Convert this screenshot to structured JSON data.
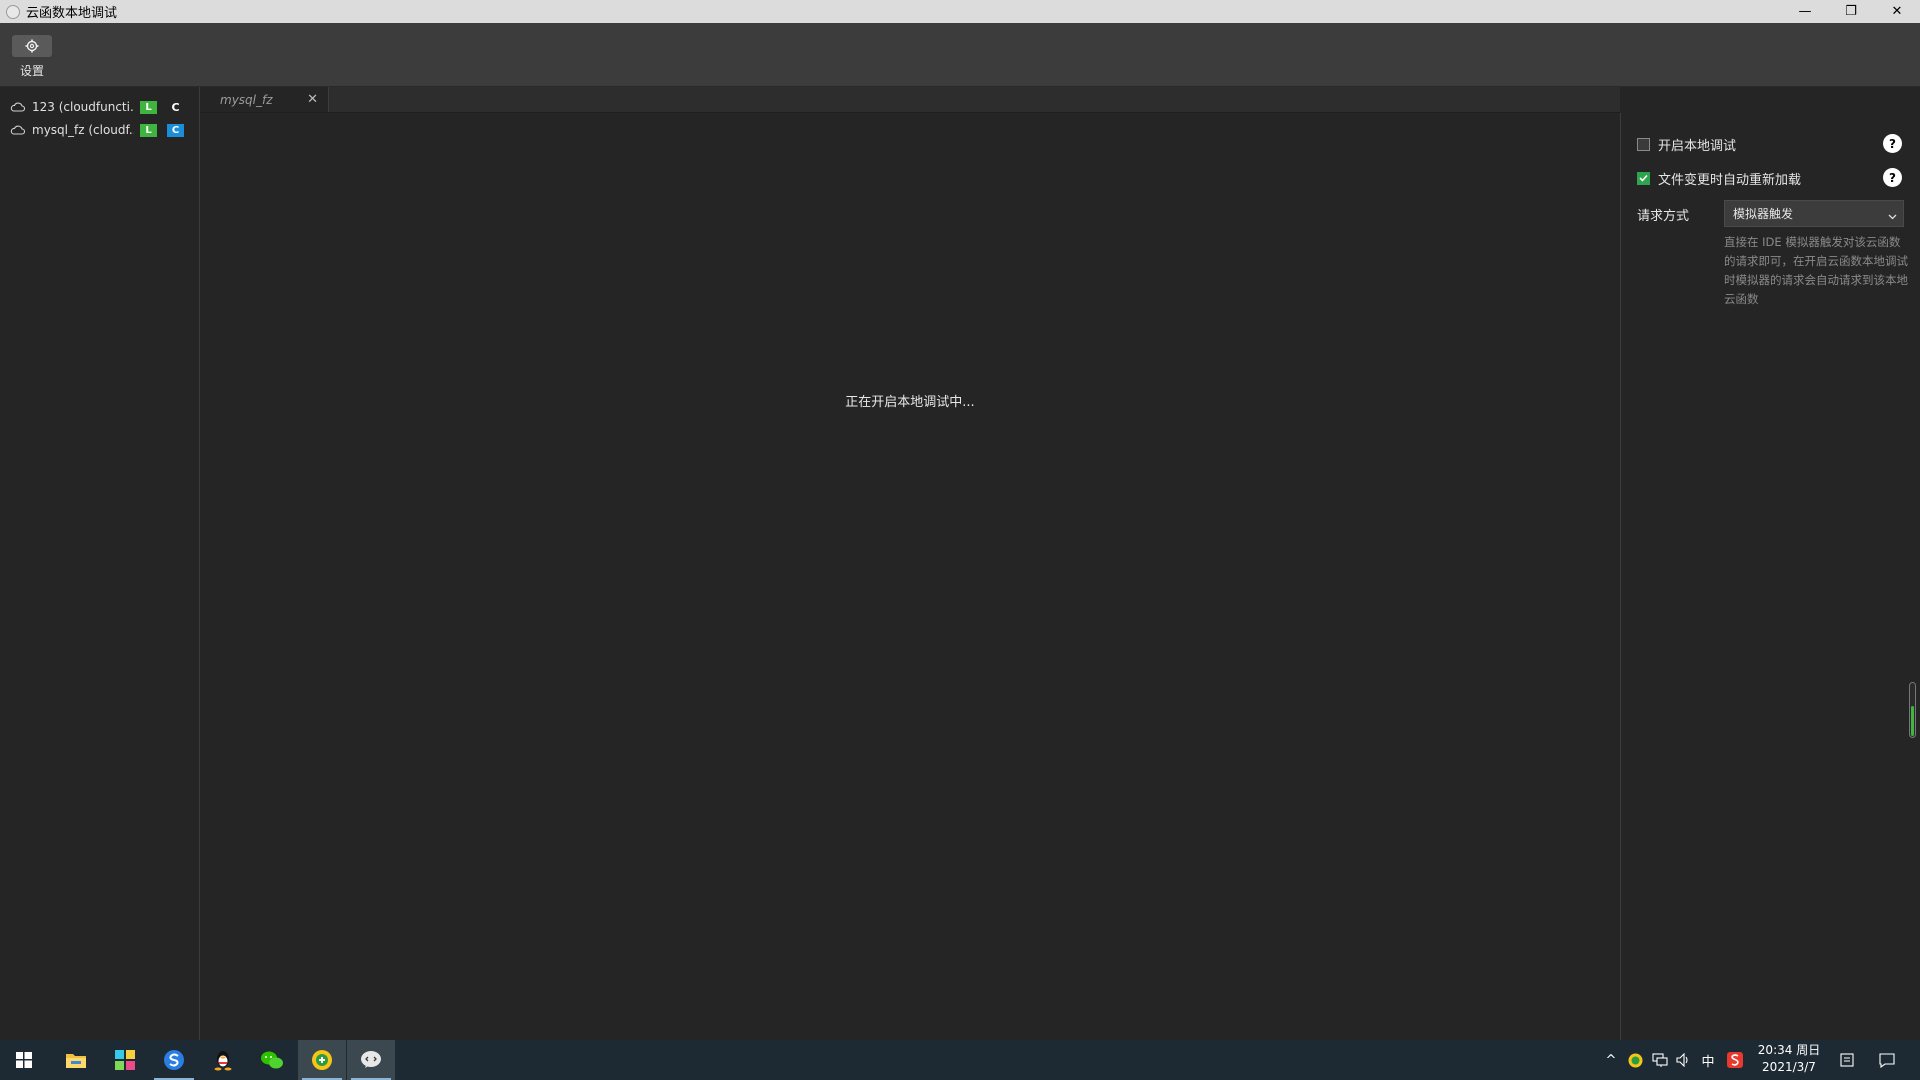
{
  "window": {
    "title": "云函数本地调试",
    "minimize_glyph": "—",
    "restore_glyph": "❐",
    "close_glyph": "✕"
  },
  "toolbar": {
    "settings_label": "设置",
    "settings_icon": "gear-icon"
  },
  "sidebar": {
    "items": [
      {
        "label": "123 (cloudfuncti...",
        "badge_l": "L",
        "badge_c": "C",
        "badge_c_style": "plain"
      },
      {
        "label": "mysql_fz (cloudf...",
        "badge_l": "L",
        "badge_c": "C",
        "badge_c_style": "blue"
      }
    ]
  },
  "tabs": [
    {
      "label": "mysql_fz",
      "close_glyph": "✕"
    }
  ],
  "main": {
    "status_text": "正在开启本地调试中..."
  },
  "panel": {
    "enable_local_debug": {
      "label": "开启本地调试",
      "checked": false
    },
    "auto_reload": {
      "label": "文件变更时自动重新加载",
      "checked": true
    },
    "help_glyph": "?",
    "request_method_label": "请求方式",
    "request_method_value": "模拟器触发",
    "request_method_desc": "直接在 IDE 模拟器触发对该云函数的请求即可，在开启云函数本地调试时模拟器的请求会自动请求到该本地云函数"
  },
  "taskbar": {
    "apps": [
      "windows-start",
      "file-explorer",
      "photos-app",
      "sogou-browser",
      "qq",
      "wechat",
      "green-app",
      "wechat-devtools"
    ],
    "tray": {
      "chevron": "^",
      "ime_label": "中",
      "time": "20:34 周日",
      "date": "2021/3/7"
    }
  },
  "colors": {
    "checkbox_checked": "#2ea44f",
    "badge_green": "#3fb53f",
    "badge_blue": "#1a8fd8"
  }
}
